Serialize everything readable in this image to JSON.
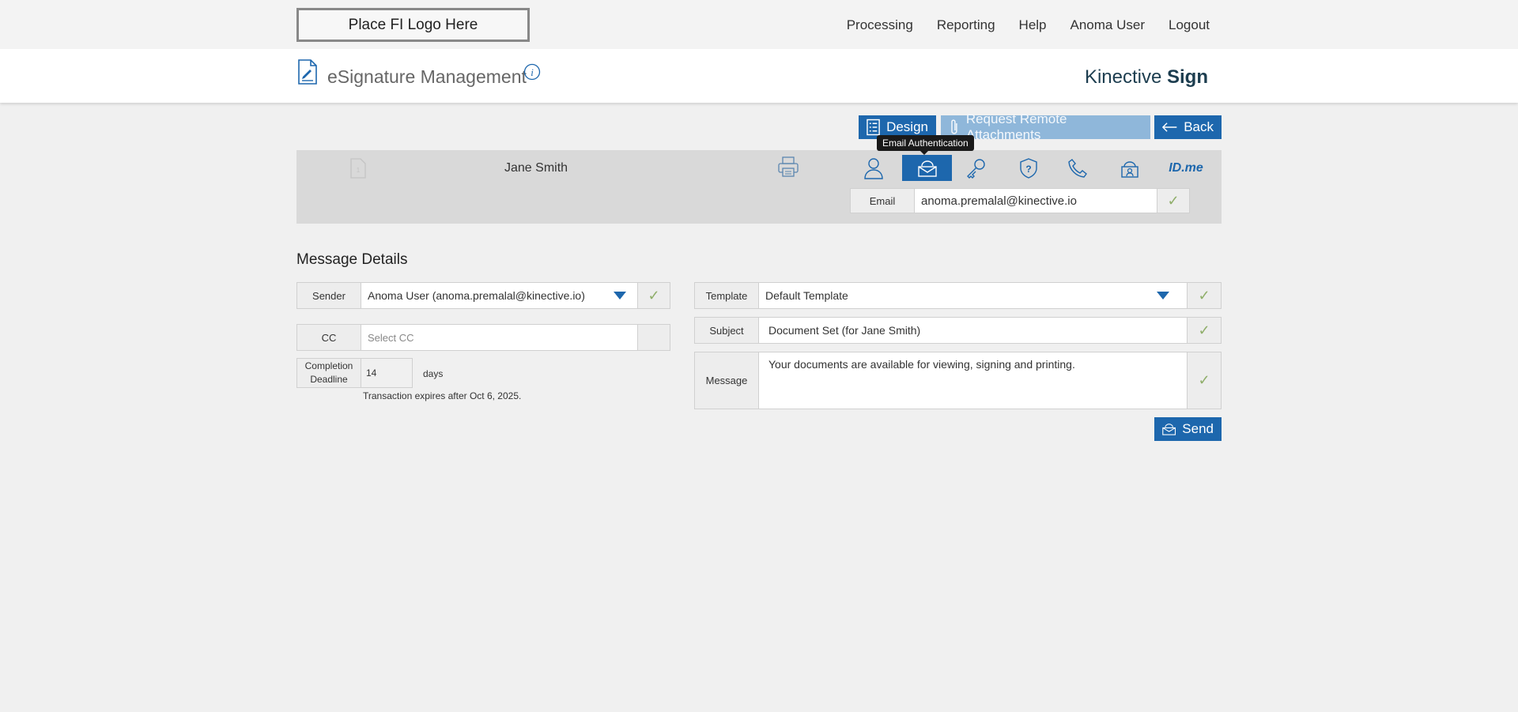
{
  "topbar": {
    "logo_text": "Place FI Logo Here",
    "nav": [
      "Processing",
      "Reporting",
      "Help",
      "Anoma User",
      "Logout"
    ]
  },
  "header": {
    "title": "eSignature Management",
    "brand_regular": "Kinective ",
    "brand_bold": "Sign"
  },
  "actions": {
    "design_label": "Design",
    "request_attachments_label": "Request Remote Attachments",
    "back_label": "Back"
  },
  "signer": {
    "name": "Jane Smith",
    "tooltip": "Email Authentication",
    "idme_label": "ID.me",
    "email_label": "Email",
    "email_value": "anoma.premalal@kinective.io"
  },
  "message_details": {
    "title": "Message Details",
    "sender_label": "Sender",
    "sender_value": "Anoma User (anoma.premalal@kinective.io)",
    "cc_label": "CC",
    "cc_placeholder": "Select CC",
    "deadline_label_1": "Completion",
    "deadline_label_2": "Deadline",
    "deadline_value": "14",
    "deadline_unit": "days",
    "expires_text": "Transaction expires after Oct 6, 2025.",
    "template_label": "Template",
    "template_value": "Default Template",
    "subject_label": "Subject",
    "subject_value": "Document Set (for Jane Smith)",
    "message_label": "Message",
    "message_value": "Your documents are available for viewing, signing and printing.",
    "send_label": "Send"
  },
  "colors": {
    "primary": "#1d67ad",
    "primary_disabled": "#8fb7da",
    "check": "#8fae6a"
  }
}
